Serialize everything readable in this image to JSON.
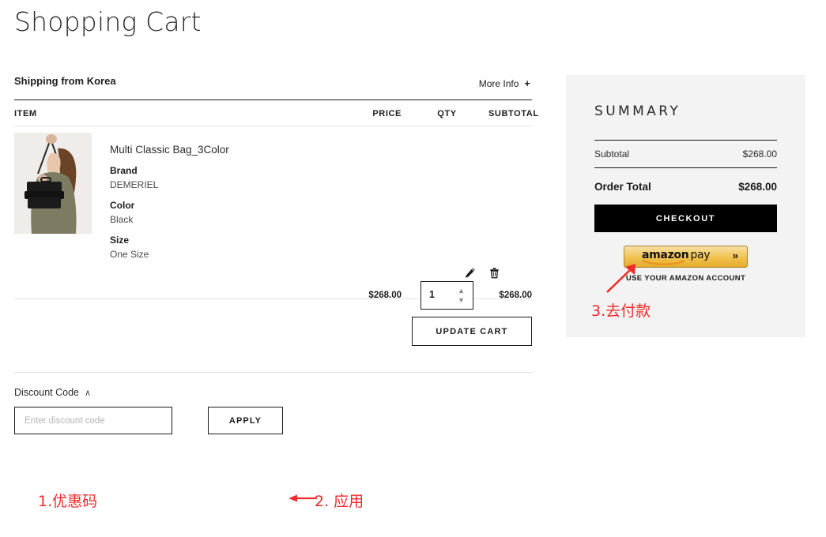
{
  "page": {
    "title": "Shopping Cart"
  },
  "cart": {
    "shipping_from": "Shipping from Korea",
    "more_info_label": "More Info",
    "more_info_plus": "+",
    "columns": {
      "item": "ITEM",
      "price": "PRICE",
      "qty": "QTY",
      "subtotal": "SUBTOTAL"
    },
    "items": [
      {
        "name": "Multi Classic Bag_3Color",
        "attributes": [
          {
            "label": "Brand",
            "value": "DEMERIEL"
          },
          {
            "label": "Color",
            "value": "Black"
          },
          {
            "label": "Size",
            "value": "One Size"
          }
        ],
        "price": "$268.00",
        "qty": "1",
        "subtotal": "$268.00",
        "image_alt": "woman-with-black-handbag-photo"
      }
    ],
    "update_cart_label": "UPDATE CART"
  },
  "discount": {
    "section_label": "Discount Code",
    "chevron": "∧",
    "placeholder": "Enter discount code",
    "value": "",
    "apply_label": "APPLY"
  },
  "summary": {
    "title": "SUMMARY",
    "rows": [
      {
        "label": "Subtotal",
        "value": "$268.00"
      }
    ],
    "order_total_label": "Order Total",
    "order_total_value": "$268.00",
    "checkout_label": "CHECKOUT",
    "amazon": {
      "brand_bold": "amazon",
      "brand_light": "pay",
      "chevron": "»",
      "subtitle": "USE YOUR AMAZON ACCOUNT"
    }
  },
  "annotations": [
    {
      "id": "1",
      "text": "1.优惠码"
    },
    {
      "id": "2",
      "text": "2. 应用"
    },
    {
      "id": "3",
      "text": "3.去付款"
    }
  ],
  "colors": {
    "annotation_red": "#ef2b2b",
    "summary_bg": "#f3f3f3",
    "checkout_bg": "#000000",
    "amazon_gold": "#f0c14b"
  }
}
